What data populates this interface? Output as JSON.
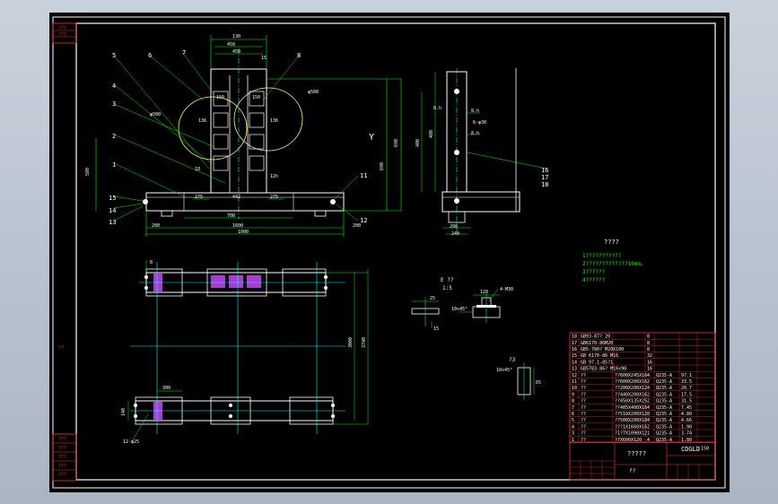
{
  "left_strip": {
    "top_labels": [
      "???",
      "???"
    ],
    "mid_label": "??",
    "bottom_labels": [
      "???",
      "???",
      "???",
      "???",
      "???"
    ]
  },
  "front_view": {
    "dims_top": [
      "130",
      "450",
      "450",
      "15"
    ],
    "dims_sides": [
      "580",
      "690",
      "690"
    ],
    "dims_bottom": [
      "275",
      "442",
      "275",
      "700",
      "1600",
      "1000",
      "200",
      "200"
    ],
    "circle_label": "φ500",
    "circle_label_right": "φ500",
    "small_dims": [
      "150",
      "150",
      "136",
      "136",
      "18",
      "12h"
    ],
    "callouts": [
      "1",
      "2",
      "3",
      "4",
      "5",
      "6",
      "7",
      "8",
      "11",
      "12",
      "13",
      "14",
      "15"
    ],
    "view_mark": "Y"
  },
  "side_view": {
    "dims": [
      "400",
      "480",
      "8.h",
      "8.h",
      "6-φ30",
      "8.h",
      "200",
      "240"
    ],
    "callouts": [
      "16",
      "17",
      "18"
    ]
  },
  "plan_view": {
    "dims": [
      "3000",
      "3740",
      "300",
      "140",
      "12-φ25"
    ],
    "top_mark": "8"
  },
  "detail_e": {
    "title": "E ??",
    "scale": "1:5",
    "dims": [
      "25",
      "15",
      "120",
      "4-M30",
      "10x45°"
    ]
  },
  "detail_small": {
    "title": "?3",
    "dims": [
      "10x45°",
      "65"
    ]
  },
  "notes": {
    "title": "????",
    "lines": [
      "1???????????",
      "2?????????????10mm。",
      "3??????",
      "4??????"
    ]
  },
  "bom": {
    "rows": [
      {
        "no": "18",
        "code": "GB93-87? 20",
        "name": "",
        "qty": "8",
        "mat": "",
        "wt": ""
      },
      {
        "no": "17",
        "code": "GB6170-86M20",
        "name": "",
        "qty": "8",
        "mat": "",
        "wt": ""
      },
      {
        "no": "16",
        "code": "GB5-780? M20X100",
        "name": "",
        "qty": "8",
        "mat": "",
        "wt": ""
      },
      {
        "no": "15",
        "code": "GB 6170-86 M16",
        "name": "",
        "qty": "32",
        "mat": "",
        "wt": ""
      },
      {
        "no": "14",
        "code": "GB 97.1-85?1",
        "name": "",
        "qty": "16",
        "mat": "",
        "wt": ""
      },
      {
        "no": "13",
        "code": "GB5783-86? M16x90",
        "name": "",
        "qty": "16",
        "mat": "",
        "wt": ""
      },
      {
        "no": "12",
        "code": "??",
        "name": "??600X245X16",
        "qty": "4",
        "mat": "Q235-A",
        "wt": "97.1"
      },
      {
        "no": "11",
        "code": "??",
        "name": "??600X200X16",
        "qty": "2",
        "mat": "Q235-A",
        "wt": "33.5"
      },
      {
        "no": "10",
        "code": "??",
        "name": "??200X200X12",
        "qty": "4",
        "mat": "Q235-A",
        "wt": "20.7"
      },
      {
        "no": "9",
        "code": "??",
        "name": "??440X200X16",
        "qty": "2",
        "mat": "Q235-A",
        "wt": "17.5"
      },
      {
        "no": "8",
        "code": "??",
        "name": "??450X135X25",
        "qty": "2",
        "mat": "Q235-A",
        "wt": "31.5"
      },
      {
        "no": "7",
        "code": "??",
        "name": "??405X400X16",
        "qty": "4",
        "mat": "Q235-A",
        "wt": "7.45"
      },
      {
        "no": "6",
        "code": "??",
        "name": "??510X200X12",
        "qty": "8",
        "mat": "Q235-A",
        "wt": "4.80"
      },
      {
        "no": "5",
        "code": "??",
        "name": "??500X200X18",
        "qty": "4",
        "mat": "Q235-A",
        "wt": "4.66"
      },
      {
        "no": "4",
        "code": "??",
        "name": "???1X1660X16",
        "qty": "2",
        "mat": "Q235-A",
        "wt": "1.90"
      },
      {
        "no": "3",
        "code": "??",
        "name": "?1?7X1090X12",
        "qty": "1",
        "mat": "Q235-A",
        "wt": "3.74"
      },
      {
        "no": "1",
        "code": "??",
        "name": "??X600X120",
        "qty": "4",
        "mat": "Q235-A",
        "wt": "1.80"
      }
    ],
    "scale_label": "1:150"
  },
  "title_block": {
    "drawing_no": "CDGLJ",
    "name": "?????",
    "unit": "??"
  }
}
